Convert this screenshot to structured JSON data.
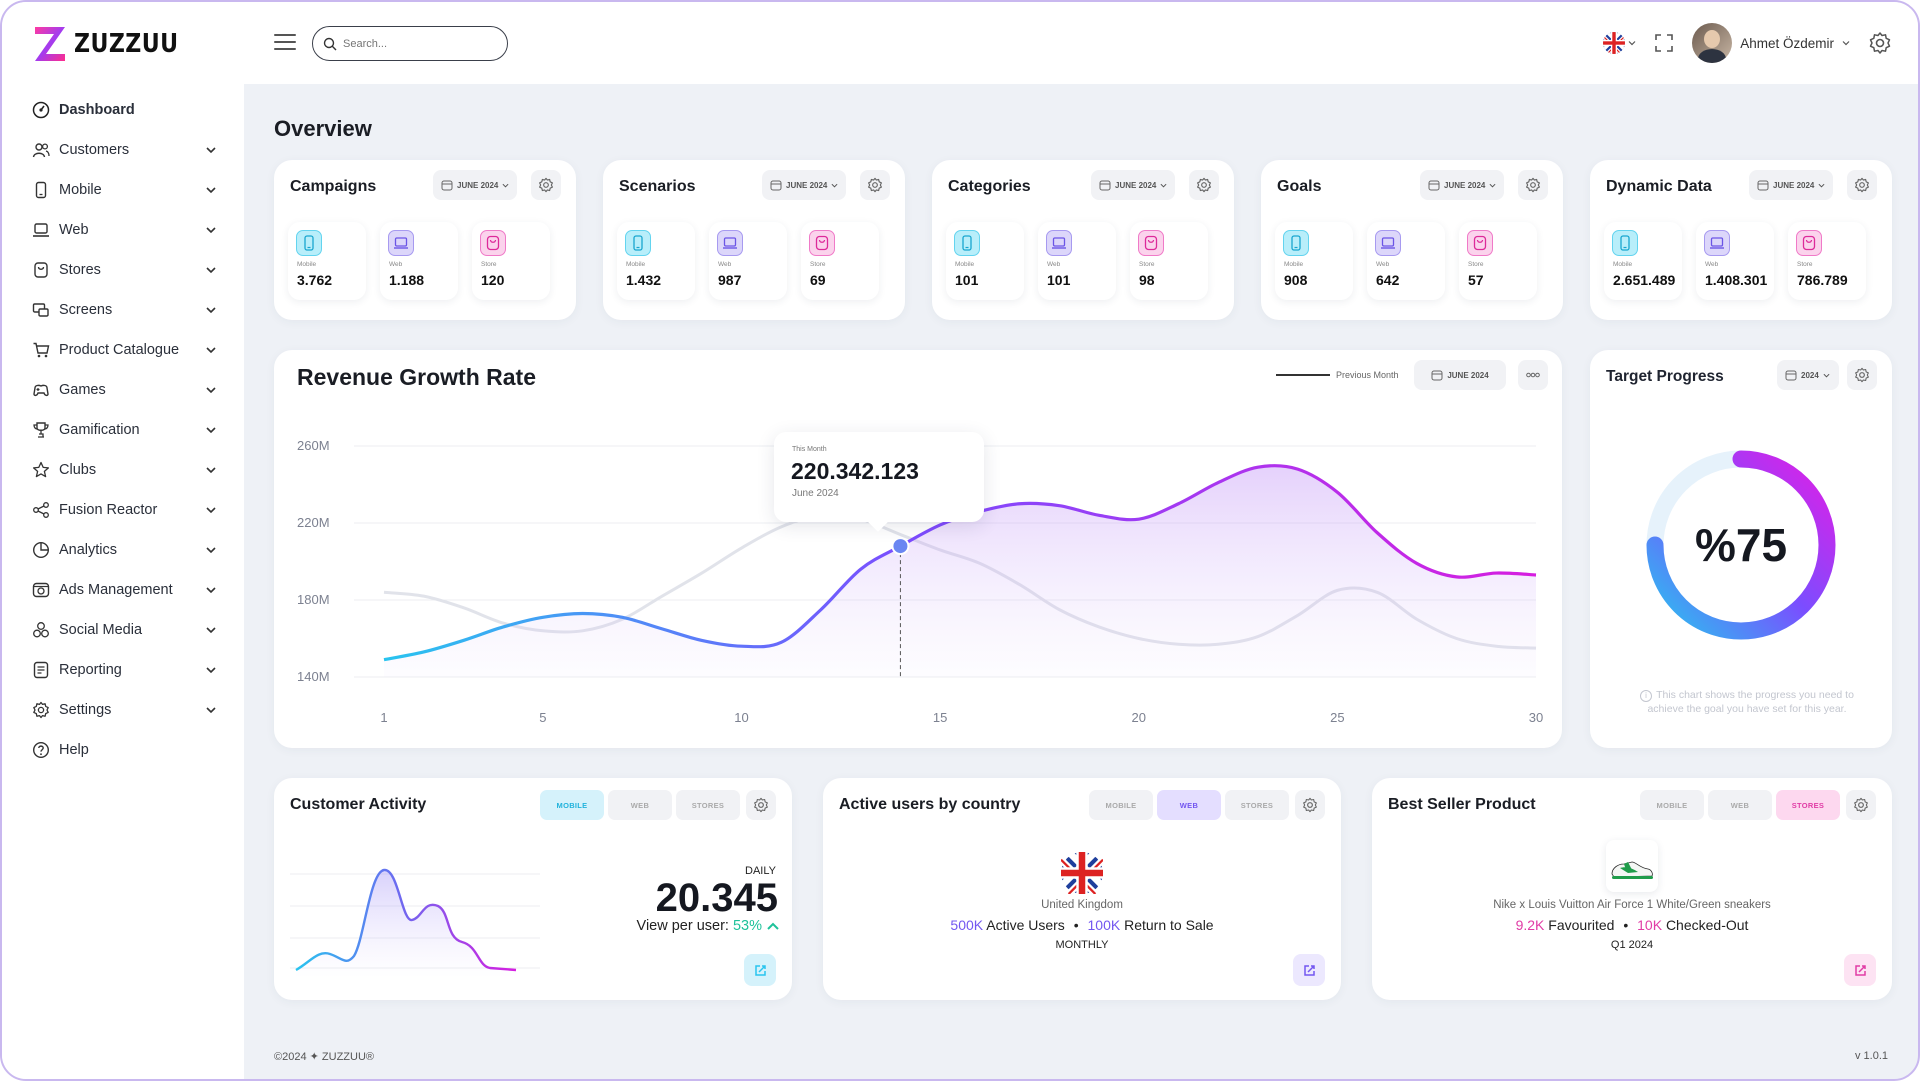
{
  "app": {
    "name": "ZUZZUU"
  },
  "sidebar": {
    "items": [
      {
        "label": "Dashboard",
        "icon": "dashboard-icon",
        "active": true,
        "chevron": false
      },
      {
        "label": "Customers",
        "icon": "users-icon",
        "chevron": true
      },
      {
        "label": "Mobile",
        "icon": "mobile-icon",
        "chevron": true
      },
      {
        "label": "Web",
        "icon": "laptop-icon",
        "chevron": true
      },
      {
        "label": "Stores",
        "icon": "store-icon",
        "chevron": true
      },
      {
        "label": "Screens",
        "icon": "screens-icon",
        "chevron": true
      },
      {
        "label": "Product Catalogue",
        "icon": "cart-icon",
        "chevron": true
      },
      {
        "label": "Games",
        "icon": "games-icon",
        "chevron": true
      },
      {
        "label": "Gamification",
        "icon": "trophy-icon",
        "chevron": true
      },
      {
        "label": "Clubs",
        "icon": "star-icon",
        "chevron": true
      },
      {
        "label": "Fusion Reactor",
        "icon": "fusion-icon",
        "chevron": true
      },
      {
        "label": "Analytics",
        "icon": "pie-chart-icon",
        "chevron": true
      },
      {
        "label": "Ads Management",
        "icon": "ads-icon",
        "chevron": true
      },
      {
        "label": "Social Media",
        "icon": "social-icon",
        "chevron": true
      },
      {
        "label": "Reporting",
        "icon": "report-icon",
        "chevron": true
      },
      {
        "label": "Settings",
        "icon": "gear-icon",
        "chevron": true
      },
      {
        "label": "Help",
        "icon": "help-icon",
        "chevron": false
      }
    ]
  },
  "topbar": {
    "search_placeholder": "Search...",
    "user_name": "Ahmet Özdemir"
  },
  "overview": {
    "title": "Overview",
    "labels": {
      "mobile": "Mobile",
      "web": "Web",
      "store": "Store"
    },
    "date_label": "JUNE 2024",
    "cards": [
      {
        "title": "Campaigns",
        "mobile": "3.762",
        "web": "1.188",
        "store": "120"
      },
      {
        "title": "Scenarios",
        "mobile": "1.432",
        "web": "987",
        "store": "69"
      },
      {
        "title": "Categories",
        "mobile": "101",
        "web": "101",
        "store": "98"
      },
      {
        "title": "Goals",
        "mobile": "908",
        "web": "642",
        "store": "57"
      },
      {
        "title": "Dynamic Data",
        "mobile": "2.651.489",
        "web": "1.408.301",
        "store": "786.789"
      }
    ]
  },
  "revenue": {
    "title": "Revenue Growth Rate",
    "legend": "Previous Month",
    "date_label": "JUNE 2024",
    "tooltip": {
      "caption": "This Month",
      "value": "220.342.123",
      "date": "June 2024"
    }
  },
  "chart_data": {
    "type": "area",
    "title": "Revenue Growth Rate",
    "xlabel": "",
    "ylabel": "",
    "x_ticks": [
      1,
      5,
      10,
      15,
      20,
      25,
      30
    ],
    "y_ticks": [
      "140M",
      "180M",
      "220M",
      "260M"
    ],
    "ylim": [
      140,
      260
    ],
    "xlim": [
      1,
      30
    ],
    "grid": true,
    "series": [
      {
        "name": "",
        "x": [
          1,
          2,
          3,
          4,
          5,
          6,
          7,
          8,
          9,
          10,
          11,
          12,
          13,
          14,
          15,
          16,
          17,
          18,
          19,
          20,
          21,
          22,
          23,
          24,
          25,
          26,
          27,
          28,
          29,
          30
        ],
        "values": [
          149,
          153,
          159,
          166,
          171,
          173,
          171,
          165,
          159,
          156,
          158,
          175,
          196,
          208,
          219,
          226,
          230,
          229,
          224,
          222,
          230,
          241,
          249,
          248,
          236,
          215,
          199,
          192,
          194,
          193
        ]
      },
      {
        "name": "Previous Month",
        "x": [
          1,
          2,
          3,
          4,
          5,
          6,
          7,
          8,
          9,
          10,
          11,
          12,
          13,
          14,
          15,
          16,
          17,
          18,
          19,
          20,
          21,
          22,
          23,
          24,
          25,
          26,
          27,
          28,
          29,
          30
        ],
        "values": [
          184,
          182,
          176,
          168,
          164,
          164,
          170,
          182,
          194,
          207,
          218,
          224,
          222,
          214,
          206,
          199,
          188,
          175,
          166,
          160,
          157,
          157,
          161,
          172,
          185,
          184,
          170,
          160,
          156,
          155
        ]
      }
    ],
    "highlight": {
      "x": 14,
      "y": 208
    }
  },
  "target": {
    "title": "Target Progress",
    "year_label": "2024",
    "value_text": "%75",
    "progress": 0.75,
    "note": "This chart shows the progress you need to achieve the goal you have set for this year."
  },
  "customer_activity": {
    "title": "Customer Activity",
    "tabs": [
      "MOBILE",
      "WEB",
      "STORES"
    ],
    "active_tab": "MOBILE",
    "period": "DAILY",
    "value": "20.345",
    "view_label": "View per user:",
    "view_value": "53%"
  },
  "active_users": {
    "title": "Active users by country",
    "tabs": [
      "MOBILE",
      "WEB",
      "STORES"
    ],
    "active_tab": "WEB",
    "country": "United Kingdom",
    "active_value": "500K",
    "active_label": "Active Users",
    "return_value": "100K",
    "return_label": "Return to Sale",
    "period": "MONTHLY"
  },
  "best_seller": {
    "title": "Best Seller Product",
    "tabs": [
      "MOBILE",
      "WEB",
      "STORES"
    ],
    "active_tab": "STORES",
    "product": "Nike x Louis Vuitton Air Force 1 White/Green sneakers",
    "fav_value": "9.2K",
    "fav_label": "Favourited",
    "checkout_value": "10K",
    "checkout_label": "Checked-Out",
    "period": "Q1 2024"
  },
  "footer": {
    "copyright": "©2024 ✦ ZUZZUU®",
    "version": "v 1.0.1"
  },
  "colors": {
    "cyan": "#29c4ef",
    "purple": "#7b4dff",
    "magenta": "#d61ee0",
    "green": "#1ec29a"
  }
}
